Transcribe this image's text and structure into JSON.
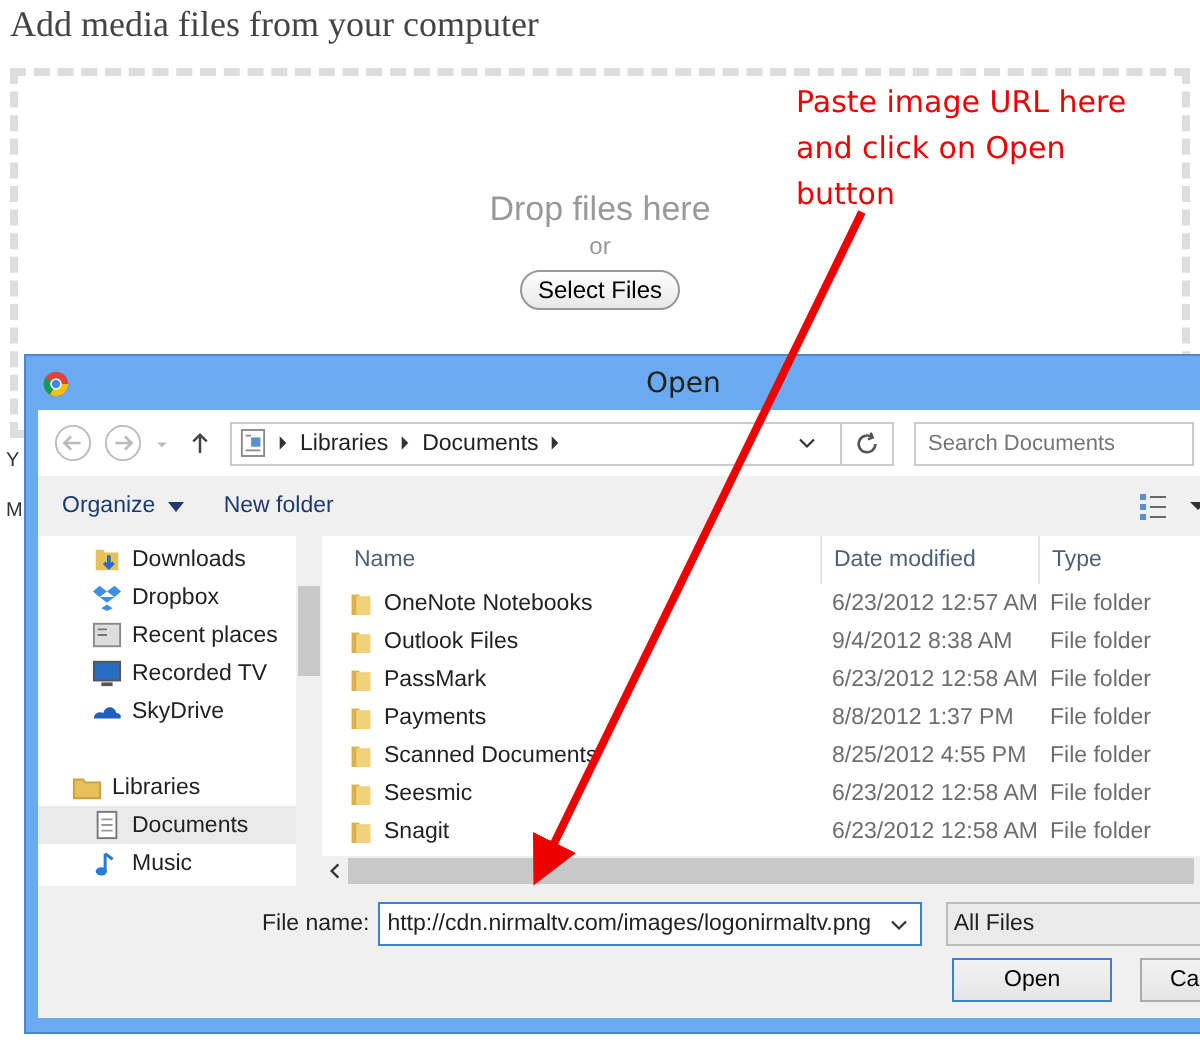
{
  "page": {
    "title": "Add media files from your computer",
    "dropzone": {
      "heading": "Drop files here",
      "or": "or",
      "button": "Select Files"
    },
    "cut_lines": [
      "Y",
      "M"
    ]
  },
  "annotation": {
    "lines": [
      "Paste image URL here",
      "and click on Open",
      "button"
    ]
  },
  "dialog": {
    "title": "Open",
    "breadcrumb": [
      "Libraries",
      "Documents"
    ],
    "search": {
      "placeholder": "Search Documents"
    },
    "toolbar": {
      "organize": "Organize",
      "new_folder": "New folder"
    },
    "nav_items": [
      {
        "label": "Downloads",
        "kind": "item",
        "selected": false
      },
      {
        "label": "Dropbox",
        "kind": "item",
        "selected": false
      },
      {
        "label": "Recent places",
        "kind": "item",
        "selected": false
      },
      {
        "label": "Recorded TV",
        "kind": "item",
        "selected": false
      },
      {
        "label": "SkyDrive",
        "kind": "item",
        "selected": false
      },
      {
        "label": "Libraries",
        "kind": "group",
        "selected": false
      },
      {
        "label": "Documents",
        "kind": "item",
        "selected": true
      },
      {
        "label": "Music",
        "kind": "item",
        "selected": false
      }
    ],
    "columns": [
      "Name",
      "Date modified",
      "Type"
    ],
    "files": [
      {
        "name": "OneNote Notebooks",
        "date": "6/23/2012 12:57 AM",
        "type": "File folder"
      },
      {
        "name": "Outlook Files",
        "date": "9/4/2012 8:38 AM",
        "type": "File folder"
      },
      {
        "name": "PassMark",
        "date": "6/23/2012 12:58 AM",
        "type": "File folder"
      },
      {
        "name": "Payments",
        "date": "8/8/2012 1:37 PM",
        "type": "File folder"
      },
      {
        "name": "Scanned Documents",
        "date": "8/25/2012 4:55 PM",
        "type": "File folder"
      },
      {
        "name": "Seesmic",
        "date": "6/23/2012 12:58 AM",
        "type": "File folder"
      },
      {
        "name": "Snagit",
        "date": "6/23/2012 12:58 AM",
        "type": "File folder"
      }
    ],
    "file_name_label": "File name:",
    "file_name": "http://cdn.nirmaltv.com/images/logonirmaltv.png",
    "file_type": "All Files",
    "buttons": [
      "Open",
      "Ca"
    ]
  }
}
